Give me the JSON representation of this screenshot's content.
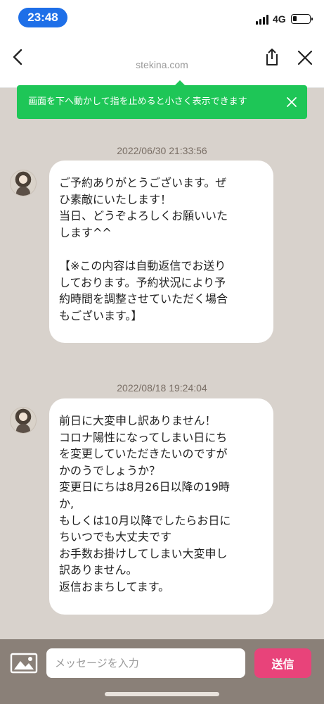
{
  "status_bar": {
    "time": "23:48",
    "network": "4G"
  },
  "header": {
    "url": "stekina.com"
  },
  "toast": {
    "text": "画面を下へ動かして指を止めると小さく表示できます"
  },
  "messages": [
    {
      "timestamp": "2022/06/30 21:33:56",
      "lines": [
        "ご予約ありがとうございます。ぜ",
        "ひ素敵にいたします！",
        "当日、どうぞよろしくお願いいた",
        "します^^",
        "",
        "【※この内容は自動返信でお送り",
        "しております。予約状況により予",
        "約時間を調整させていただく場合",
        "もございます。】"
      ]
    },
    {
      "timestamp": "2022/08/18 19:24:04",
      "lines": [
        "前日に大変申し訳ありません！",
        "コロナ陽性になってしまい日にち",
        "を変更していただきたいのですが",
        "かのうでしょうか？",
        "変更日にちは8月26日以降の19時",
        "か,",
        "もしくは10月以降でしたらお日に",
        "ちいつでも大丈夫です",
        "お手数お掛けしてしまい大変申し",
        "訳ありません。",
        "返信おまちしてます。"
      ]
    }
  ],
  "input_bar": {
    "placeholder": "メッセージを入力",
    "send_label": "送信"
  },
  "colors": {
    "accent_send": "#e8437a",
    "toast_green": "#1ec657",
    "time_pill": "#1e6fe8",
    "chat_background": "#d8d2cc"
  }
}
